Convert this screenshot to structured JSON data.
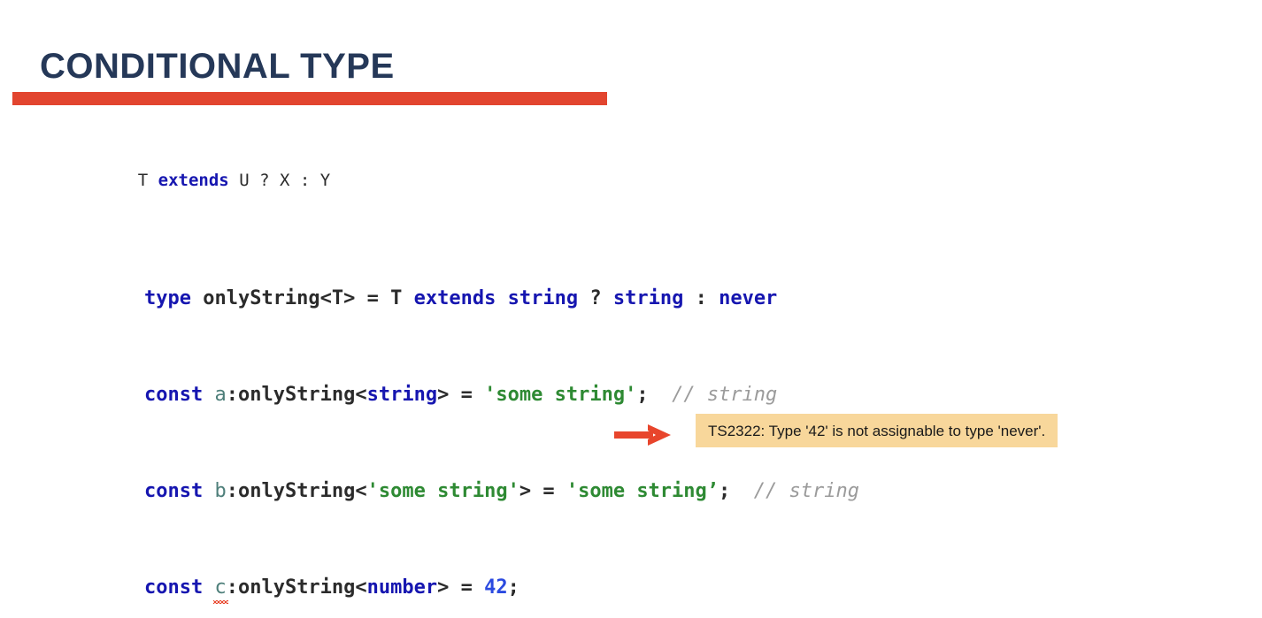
{
  "slide": {
    "background_color": "#ffffff",
    "title": "CONDITIONAL TYPE",
    "title_color": "#253858",
    "rule_color": "#e2452f"
  },
  "colors": {
    "keyword": "#1616b0",
    "plain": "#2b2b2b",
    "variable": "#4e7f7a",
    "string": "#2e8a33",
    "number": "#2b4ae0",
    "comment": "#9b9b9b",
    "error_squiggle": "#e8452c",
    "arrow": "#e8452c",
    "tooltip_background": "#f8d79b",
    "tooltip_text": "#1a1a1a"
  },
  "code": {
    "signature": {
      "t": "T",
      "space1": " ",
      "extends": "extends",
      "space2": " ",
      "rest": "U ? X : Y"
    },
    "line_type_alias": {
      "kw_type": "type",
      "name": " onlyString<T> = T ",
      "kw_extends": "extends",
      "sp1": " ",
      "kw_string1": "string",
      "q": " ? ",
      "kw_string2": "string",
      "colon": " : ",
      "kw_never": "never"
    },
    "line_a": {
      "kw_const": "const",
      "sp1": " ",
      "var": "a",
      "mid": ":onlyString<",
      "kw_string": "string",
      "close": "> = ",
      "value": "'some string'",
      "semi": ";",
      "gap": "  ",
      "comment": "// string"
    },
    "line_b": {
      "kw_const": "const",
      "sp1": " ",
      "var": "b",
      "mid": ":onlyString<",
      "generic": "'some string'",
      "close": "> = ",
      "value": "'some string’",
      "semi": ";",
      "gap": "  ",
      "comment": "// string"
    },
    "line_c": {
      "kw_const": "const",
      "sp1": " ",
      "var": "c",
      "mid": ":onlyString<",
      "kw_number": "number",
      "close": "> = ",
      "value": "42",
      "semi": ";"
    }
  },
  "annotation": {
    "arrow_icon": "arrow-right-icon",
    "error_message": "TS2322: Type '42' is not assignable to type 'never'."
  }
}
